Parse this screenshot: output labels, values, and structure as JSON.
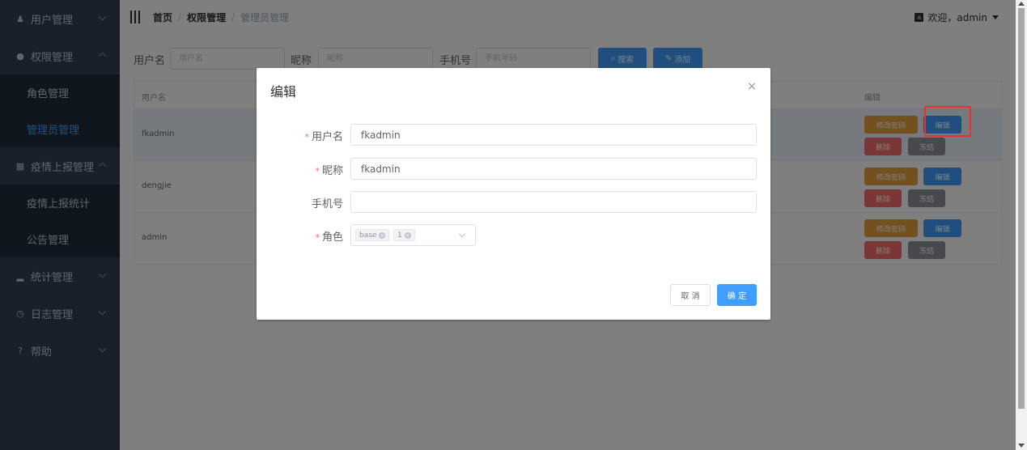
{
  "sidebar": {
    "items": [
      {
        "label": "用户管理",
        "icon": "user-icon",
        "glyph": "♟"
      },
      {
        "label": "权限管理",
        "icon": "location-icon",
        "glyph": "●"
      },
      {
        "label": "角色管理"
      },
      {
        "label": "管理员管理"
      },
      {
        "label": "疫情上报管理",
        "icon": "grid-icon",
        "glyph": "▦"
      },
      {
        "label": "疫情上报统计"
      },
      {
        "label": "公告管理"
      },
      {
        "label": "统计管理",
        "icon": "bar-chart-icon",
        "glyph": "▂"
      },
      {
        "label": "日志管理",
        "icon": "clock-icon",
        "glyph": "◷"
      },
      {
        "label": "帮助",
        "icon": "question-icon",
        "glyph": "?"
      }
    ]
  },
  "header": {
    "breadcrumb": [
      "首页",
      "权限管理",
      "管理员管理"
    ],
    "breadcrumb_sep": "/",
    "welcome": "欢迎，admin",
    "avatar_icon": "avatar-icon"
  },
  "search": {
    "username_label": "用户名",
    "username_placeholder": "用户名",
    "nickname_label": "昵称",
    "nickname_placeholder": "昵称",
    "phone_label": "手机号",
    "phone_placeholder": "手机号码",
    "search_button": "搜索",
    "add_button": "添加"
  },
  "table": {
    "columns": [
      "用户名",
      "编辑"
    ],
    "rows": [
      "fkadmin",
      "dengjie",
      "admin"
    ],
    "actions": {
      "change_password": "修改密码",
      "edit": "编辑",
      "delete": "删除",
      "freeze": "冻结"
    }
  },
  "dialog": {
    "title": "编辑",
    "close": "×",
    "username_label": "用户名",
    "username_value": "fkadmin",
    "nickname_label": "昵称",
    "nickname_value": "fkadmin",
    "phone_label": "手机号",
    "phone_value": "",
    "role_label": "角色",
    "role_tags": [
      "base",
      "1"
    ],
    "required_mark": "*",
    "cancel_button": "取 消",
    "confirm_button": "确 定"
  },
  "colors": {
    "sidebar_bg": "#304156",
    "primary": "#409eff",
    "warning": "#e6a23c",
    "danger": "#f56c6c",
    "info": "#909399",
    "highlight_box": "#e8322c"
  }
}
